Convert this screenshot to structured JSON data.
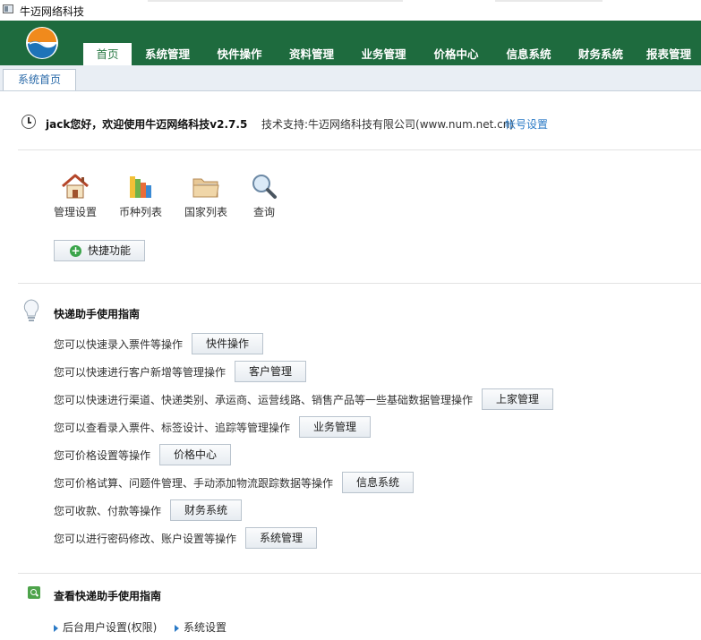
{
  "window": {
    "title": "牛迈网络科技"
  },
  "nav": {
    "items": [
      {
        "label": "首页",
        "active": true
      },
      {
        "label": "系统管理"
      },
      {
        "label": "快件操作"
      },
      {
        "label": "资料管理"
      },
      {
        "label": "业务管理"
      },
      {
        "label": "价格中心"
      },
      {
        "label": "信息系统"
      },
      {
        "label": "财务系统"
      },
      {
        "label": "报表管理"
      }
    ]
  },
  "tabs": [
    {
      "label": "系统首页"
    }
  ],
  "welcome": {
    "greeting": "jack您好，欢迎使用牛迈网络科技v2.7.5",
    "tech_support": "技术支持:牛迈网络科技有限公司(www.num.net.cn)",
    "account_link": "帐号设置"
  },
  "quick_icons": [
    {
      "label": "管理设置",
      "icon": "house-icon"
    },
    {
      "label": "币种列表",
      "icon": "books-icon"
    },
    {
      "label": "国家列表",
      "icon": "folder-icon"
    },
    {
      "label": "查询",
      "icon": "magnifier-icon"
    }
  ],
  "quick_button": {
    "label": "快捷功能"
  },
  "guide": {
    "title": "快递助手使用指南",
    "rows": [
      {
        "text": "您可以快速录入票件等操作",
        "button": "快件操作"
      },
      {
        "text": "您可以快速进行客户新增等管理操作",
        "button": "客户管理"
      },
      {
        "text": "您可以快速进行渠道、快递类别、承运商、运营线路、销售产品等一些基础数据管理操作",
        "button": "上家管理"
      },
      {
        "text": "您可以查看录入票件、标签设计、追踪等管理操作",
        "button": "业务管理"
      },
      {
        "text": "您可价格设置等操作",
        "button": "价格中心"
      },
      {
        "text": "您可价格试算、问题件管理、手动添加物流跟踪数据等操作",
        "button": "信息系统"
      },
      {
        "text": "您可收款、付款等操作",
        "button": "财务系统"
      },
      {
        "text": "您可以进行密码修改、账户设置等操作",
        "button": "系统管理"
      }
    ]
  },
  "view_guide": {
    "title": "查看快递助手使用指南",
    "links": [
      "后台用户设置(权限)",
      "系统设置"
    ]
  },
  "colors": {
    "header_bg": "#1e6b3e",
    "link": "#2a7ac6",
    "tab_text": "#2a6aa9"
  }
}
